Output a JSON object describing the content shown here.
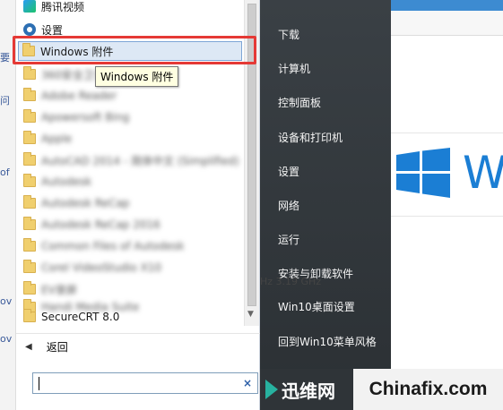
{
  "background_left": {
    "frags": [
      "要",
      "问",
      "of",
      "ov",
      "ov"
    ]
  },
  "programs": [
    {
      "label": "腾讯视频",
      "icon": "tencent-video-icon",
      "kind": "app",
      "blurred": false
    },
    {
      "label": "设置",
      "icon": "gear-icon",
      "kind": "settings",
      "blurred": false
    },
    {
      "label": "Windows 附件",
      "icon": "folder-icon",
      "kind": "folder",
      "blurred": false,
      "selected": true
    },
    {
      "label": "360安全卫士",
      "icon": "folder-icon",
      "kind": "folder",
      "blurred": true
    },
    {
      "label": "Adobe Reader",
      "icon": "folder-icon",
      "kind": "folder",
      "blurred": true
    },
    {
      "label": "Apowersoft Bing",
      "icon": "folder-icon",
      "kind": "folder",
      "blurred": true
    },
    {
      "label": "Apple",
      "icon": "folder-icon",
      "kind": "folder",
      "blurred": true
    },
    {
      "label": "AutoCAD 2014 - 简体中文 (Simplified)",
      "icon": "folder-icon",
      "kind": "folder",
      "blurred": true
    },
    {
      "label": "Autodesk",
      "icon": "folder-icon",
      "kind": "folder",
      "blurred": true
    },
    {
      "label": "Autodesk ReCap",
      "icon": "folder-icon",
      "kind": "folder",
      "blurred": true
    },
    {
      "label": "Autodesk ReCap 2016",
      "icon": "folder-icon",
      "kind": "folder",
      "blurred": true
    },
    {
      "label": "Common Files of Autodesk",
      "icon": "folder-icon",
      "kind": "folder",
      "blurred": true
    },
    {
      "label": "Corel VideoStudio X10",
      "icon": "folder-icon",
      "kind": "folder",
      "blurred": true
    },
    {
      "label": "EV录屏",
      "icon": "folder-icon",
      "kind": "folder",
      "blurred": true
    },
    {
      "label": "Handi Media Suite",
      "icon": "folder-icon",
      "kind": "folder",
      "blurred": true
    },
    {
      "label": "SecureCRT 8.0",
      "icon": "folder-icon",
      "kind": "folder",
      "blurred": false
    }
  ],
  "tooltip": "Windows 附件",
  "back_label": "返回",
  "search": {
    "value": "",
    "clear_symbol": "×"
  },
  "right_menu": [
    "下载",
    "计算机",
    "控制面板",
    "设备和打印机",
    "设置",
    "网络",
    "运行",
    "安装与卸载软件",
    "Win10桌面设置",
    "回到Win10菜单风格"
  ],
  "desktop": {
    "win_text": "W",
    "cpu_text": "Hz   3.19 GHz"
  },
  "watermark": {
    "left": "迅维网",
    "right": "Chinafix.com"
  },
  "colors": {
    "accent": "#1b7ed4",
    "highlight_border": "#e53935",
    "right_panel_bg": "#2e3438"
  }
}
